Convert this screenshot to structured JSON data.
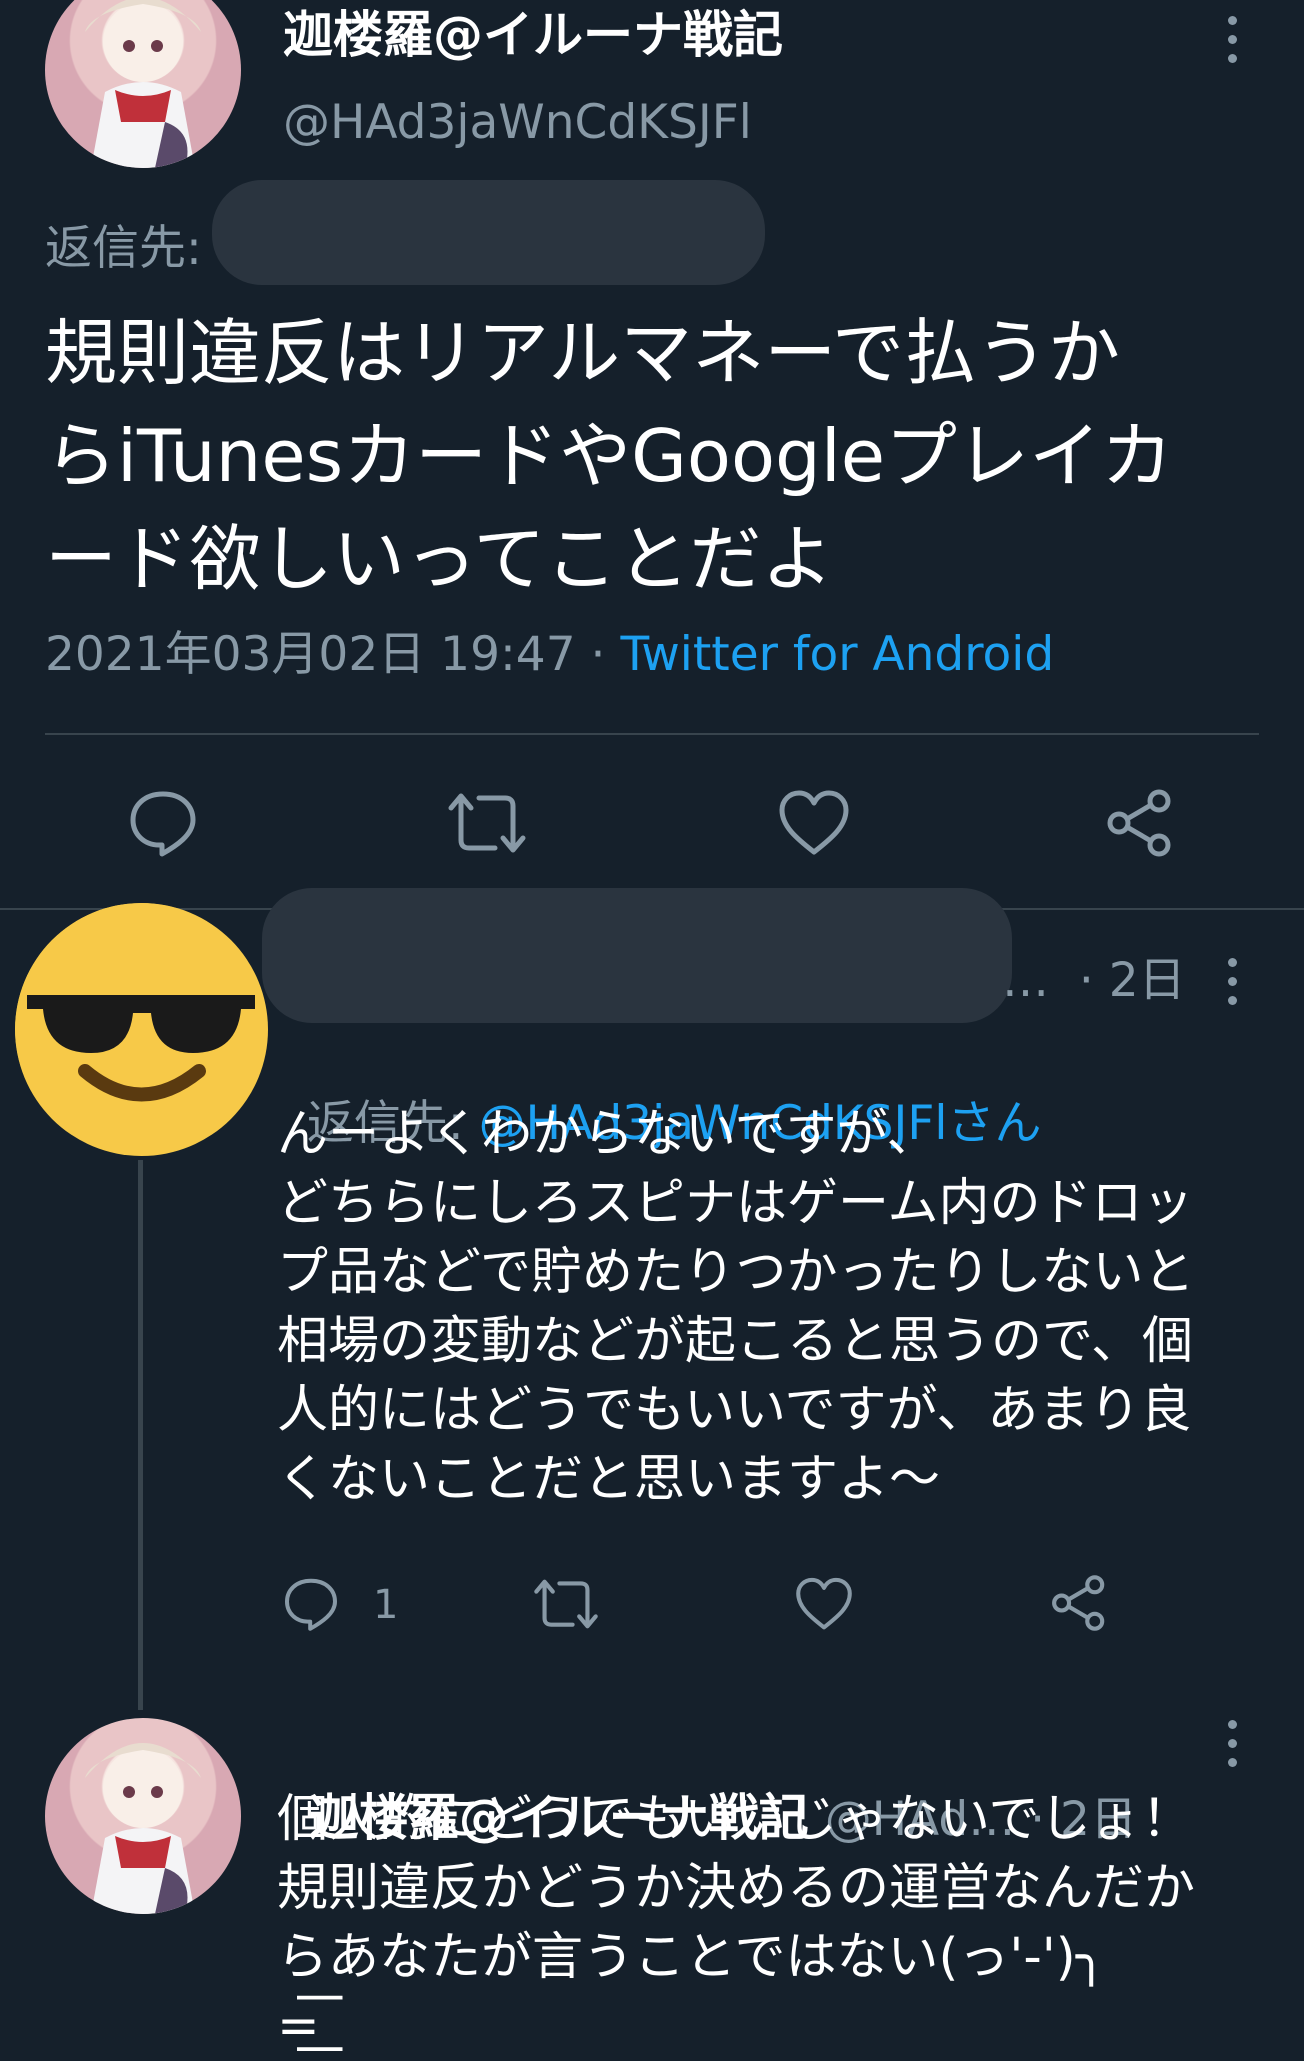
{
  "main_tweet": {
    "display_name": "迦楼羅@イルーナ戦記",
    "handle": "@HAd3jaWnCdKSJFl",
    "reply_to_label": "返信先:",
    "text": "規則違反はリアルマネーで払うか\nらiTunesカードやGoogleプレイカ\nード欲しいってことだよ",
    "timestamp": "2021年03月02日 19:47 · ",
    "client": "Twitter for Android",
    "actions": [
      "reply-icon",
      "retweet-icon",
      "like-icon",
      "share-icon"
    ]
  },
  "reply_tweet": {
    "time": "…  · 2日",
    "reply_to_label": "返信先: ",
    "reply_to_handle": "@HAd3jaWnCdKSJFlさん",
    "text": "んーよくわからないですが、\nどちらにしろスピナはゲーム内のドロッ\nプ品などで貯めたりつかったりしないと\n相場の変動などが起こると思うので、個\n人的にはどうでもいいですが、あまり良\nくないことだと思いますよ〜",
    "reply_count": "1",
    "avatar_icon": "sunglasses-emoji-icon"
  },
  "third_tweet": {
    "display_name": "迦楼羅@イルーナ戦記",
    "handle": "@HAd…",
    "time": " · 2日",
    "text": "個人的にどうでもいいじゃないでしょ！\n規則違反かどうか決めるの運営なんだか\nらあなたが言うことではない(っ'-')╮\n=͟͟͞͞"
  },
  "colors": {
    "background": "#15202b",
    "secondary_text": "#8899a6",
    "link": "#1da1f2",
    "divider": "#38444d"
  }
}
